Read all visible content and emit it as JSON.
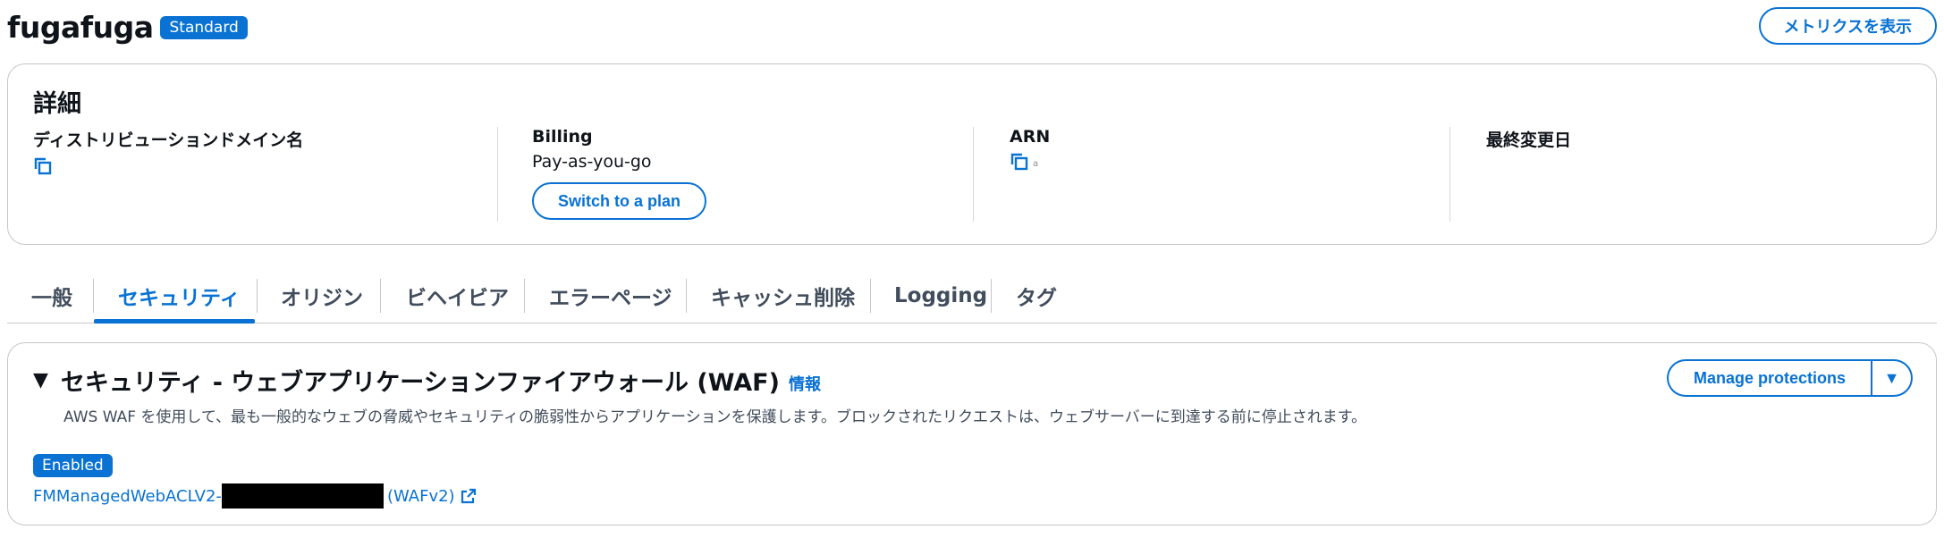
{
  "header": {
    "title": "fugafuga",
    "badge": "Standard",
    "metrics_button": "メトリクスを表示"
  },
  "details": {
    "title": "詳細",
    "domain": {
      "label": "ディストリビューションドメイン名"
    },
    "billing": {
      "label": "Billing",
      "value": "Pay-as-you-go",
      "plan_button": "Switch to a plan"
    },
    "arn": {
      "label": "ARN",
      "value_truncated": "a"
    },
    "modified": {
      "label": "最終変更日"
    }
  },
  "tabs": [
    {
      "label": "一般"
    },
    {
      "label": "セキュリティ"
    },
    {
      "label": "オリジン"
    },
    {
      "label": "ビヘイビア"
    },
    {
      "label": "エラーページ"
    },
    {
      "label": "キャッシュ削除"
    },
    {
      "label": "Logging"
    },
    {
      "label": "タグ"
    }
  ],
  "waf": {
    "title": "セキュリティ - ウェブアプリケーションファイアウォール (WAF)",
    "info_link": "情報",
    "description": "AWS WAF を使用して、最も一般的なウェブの脅威やセキュリティの脆弱性からアプリケーションを保護します。ブロックされたリクエストは、ウェブサーバーに到達する前に停止されます。",
    "manage_button": "Manage protections",
    "status_badge": "Enabled",
    "acl_prefix": "FMManagedWebACLV2-",
    "acl_suffix": "(WAFv2)"
  },
  "colors": {
    "accent": "#0972d3",
    "text": "#0f141a",
    "secondary_text": "#414d5c",
    "border": "#c6c6cd"
  },
  "icons": [
    "copy-icon",
    "caret-down-icon",
    "external-link-icon"
  ]
}
